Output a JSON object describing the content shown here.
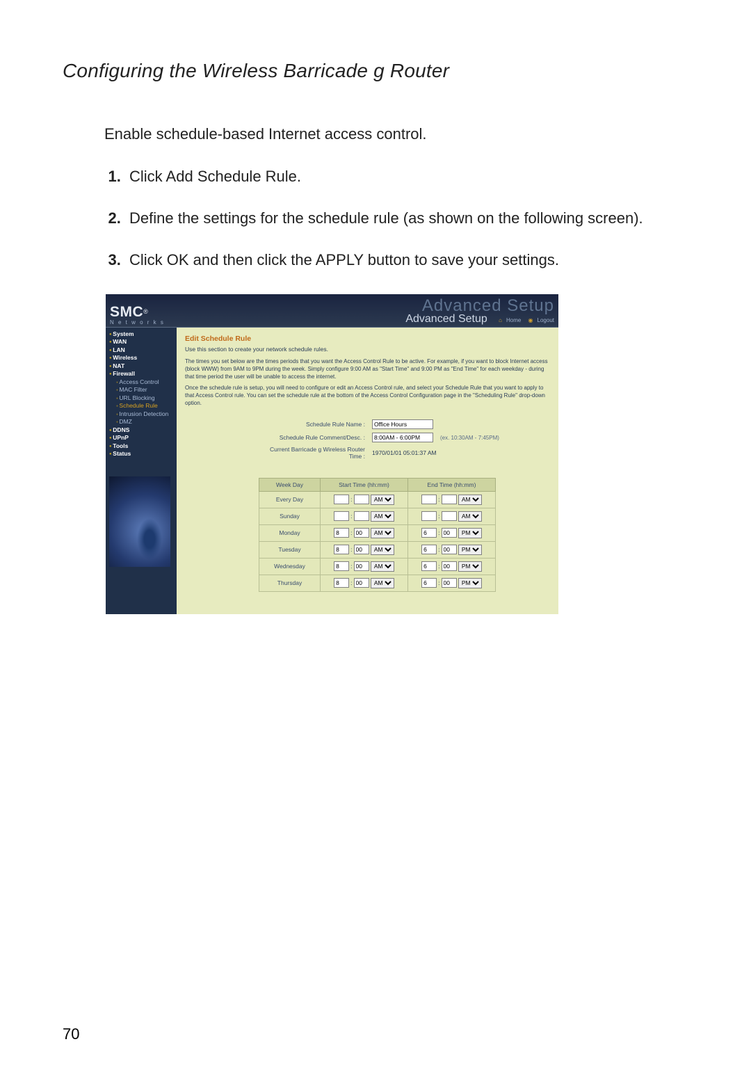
{
  "doc": {
    "title": "Configuring the Wireless Barricade g Router",
    "intro": "Enable schedule-based Internet access control.",
    "steps": [
      "Click Add Schedule Rule.",
      "Define the settings for the schedule rule (as shown on the following screen).",
      "Click OK and then click the APPLY button to save your settings."
    ],
    "page_number": "70"
  },
  "shot": {
    "brand": {
      "name": "SMC",
      "reg": "®",
      "sub": "N e t w o r k s"
    },
    "header": {
      "ghost": "Advanced Setup",
      "title": "Advanced Setup",
      "home": "Home",
      "logout": "Logout"
    },
    "nav": {
      "top": [
        "System",
        "WAN",
        "LAN",
        "Wireless",
        "NAT",
        "Firewall"
      ],
      "firewall_sub": [
        "Access Control",
        "MAC Filter",
        "URL Blocking",
        "Schedule Rule",
        "Intrusion Detection",
        "DMZ"
      ],
      "tail": [
        "DDNS",
        "UPnP",
        "Tools",
        "Status"
      ],
      "active_sub": "Schedule Rule"
    },
    "section": {
      "title": "Edit Schedule Rule",
      "subtitle": "Use this section to create your network schedule rules.",
      "para1": "The times you set below are the times periods that you want the Access Control Rule to be active. For example, if you want to block Internet access (block WWW) from 9AM to 9PM during the week. Simply configure 9:00 AM as \"Start Time\" and 9:00 PM as \"End Time\" for each weekday - during that time period the user will be unable to access the internet.",
      "para2": "Once the schedule rule is setup, you will need to configure or edit an Access Control rule, and select your Schedule Rule that you want to apply to that Access Control rule. You can set the schedule rule at the bottom of the Access Control Configuration page in the \"Scheduling Rule\" drop-down option."
    },
    "meta": {
      "name_label": "Schedule Rule Name :",
      "name_value": "Office Hours",
      "comment_label": "Schedule Rule Comment/Desc. :",
      "comment_value": "8:00AM - 6:00PM",
      "comment_hint": "(ex. 10:30AM - 7:45PM)",
      "time_label": "Current Barricade g Wireless Router Time :",
      "time_value": "1970/01/01 05:01:37 AM"
    },
    "table": {
      "headers": [
        "Week Day",
        "Start Time (hh:mm)",
        "End Time (hh:mm)"
      ],
      "rows": [
        {
          "day": "Every Day",
          "start_hh": "",
          "start_mm": "",
          "start_ap": "AM",
          "end_hh": "",
          "end_mm": "",
          "end_ap": "AM"
        },
        {
          "day": "Sunday",
          "start_hh": "",
          "start_mm": "",
          "start_ap": "AM",
          "end_hh": "",
          "end_mm": "",
          "end_ap": "AM"
        },
        {
          "day": "Monday",
          "start_hh": "8",
          "start_mm": "00",
          "start_ap": "AM",
          "end_hh": "6",
          "end_mm": "00",
          "end_ap": "PM"
        },
        {
          "day": "Tuesday",
          "start_hh": "8",
          "start_mm": "00",
          "start_ap": "AM",
          "end_hh": "6",
          "end_mm": "00",
          "end_ap": "PM"
        },
        {
          "day": "Wednesday",
          "start_hh": "8",
          "start_mm": "00",
          "start_ap": "AM",
          "end_hh": "6",
          "end_mm": "00",
          "end_ap": "PM"
        },
        {
          "day": "Thursday",
          "start_hh": "8",
          "start_mm": "00",
          "start_ap": "AM",
          "end_hh": "6",
          "end_mm": "00",
          "end_ap": "PM"
        }
      ],
      "ampm_options": [
        "AM",
        "PM"
      ]
    }
  }
}
